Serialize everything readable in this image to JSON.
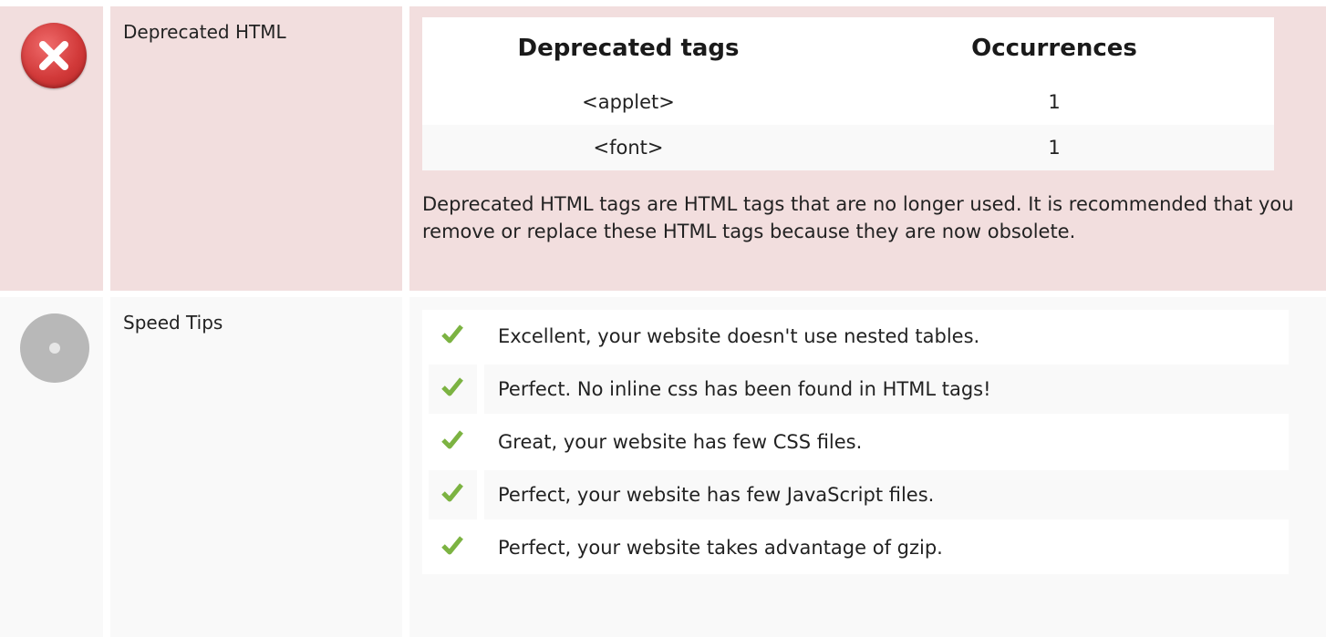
{
  "deprecated": {
    "label": "Deprecated HTML",
    "status_icon": "error-x-icon",
    "table": {
      "headers": [
        "Deprecated tags",
        "Occurrences"
      ],
      "rows": [
        {
          "tag": "<applet>",
          "count": "1"
        },
        {
          "tag": "<font>",
          "count": "1"
        }
      ]
    },
    "description": "Deprecated HTML tags are HTML tags that are no longer used. It is recommended that you remove or replace these HTML tags because they are now obsolete."
  },
  "speed": {
    "label": "Speed Tips",
    "status_icon": "neutral-dot-icon",
    "tips": [
      "Excellent, your website doesn't use nested tables.",
      "Perfect. No inline css has been found in HTML tags!",
      "Great, your website has few CSS files.",
      "Perfect, your website has few JavaScript files.",
      "Perfect, your website takes advantage of gzip."
    ],
    "tip_icon": "checkmark-icon"
  },
  "colors": {
    "error_bg": "#f2dede",
    "neutral_bg": "#f9f9f9",
    "error_icon": "#d23a3a",
    "check": "#7cb342"
  }
}
